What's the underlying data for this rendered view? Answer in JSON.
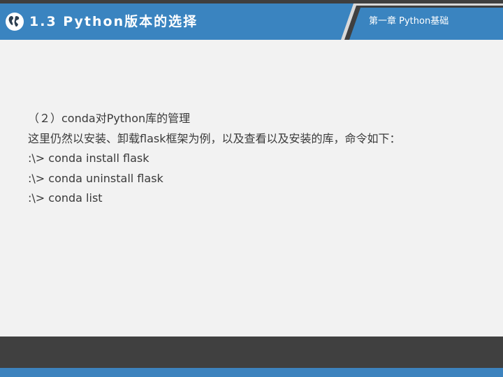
{
  "header": {
    "title": "1.3 Python版本的选择",
    "chapter": "第一章 Python基础",
    "icon": "globe-icon",
    "colors": {
      "blue": "#3a84c0",
      "dark": "#3f3f3f",
      "accent_border": "#dcdcdc"
    }
  },
  "content": {
    "lines": [
      "（２）conda对Python库的管理",
      "这里仍然以安装、卸载flask框架为例，以及查看以及安装的库，命令如下：",
      ":\\> conda install flask",
      ":\\> conda uninstall flask",
      ":\\> conda list"
    ]
  },
  "footer": {
    "colors": {
      "dark": "#404040",
      "blue": "#3d83be"
    }
  }
}
